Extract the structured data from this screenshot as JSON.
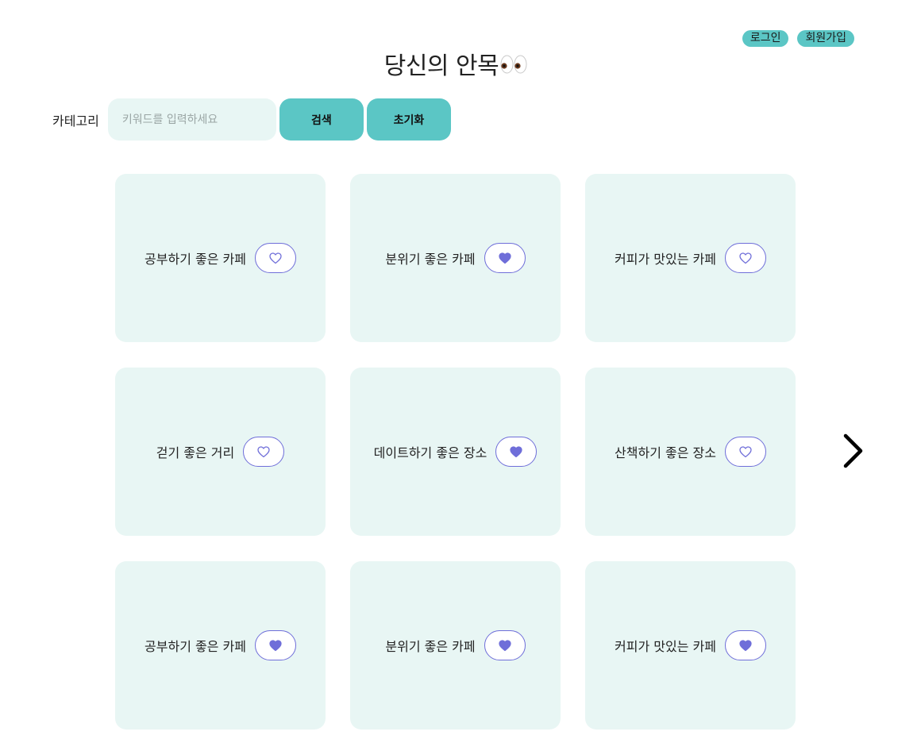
{
  "header": {
    "login_label": "로그인",
    "signup_label": "회원가입",
    "title": "당신의 안목"
  },
  "search": {
    "label": "카테고리",
    "placeholder": "키워드를 입력하세요",
    "value": "",
    "search_button": "검색",
    "reset_button": "초기화"
  },
  "cards": [
    {
      "title": "공부하기 좋은 카페",
      "liked": false
    },
    {
      "title": "분위기 좋은 카페",
      "liked": true
    },
    {
      "title": "커피가 맛있는 카페",
      "liked": false
    },
    {
      "title": "걷기 좋은 거리",
      "liked": false
    },
    {
      "title": "데이트하기 좋은 장소",
      "liked": true
    },
    {
      "title": "산책하기 좋은 장소",
      "liked": false
    },
    {
      "title": "공부하기 좋은 카페",
      "liked": true
    },
    {
      "title": "분위기 좋은 카페",
      "liked": true
    },
    {
      "title": "커피가 맛있는 카페",
      "liked": true
    }
  ],
  "colors": {
    "accent": "#5bc6c5",
    "card_bg": "#e8f6f4",
    "heart": "#6f6ed9"
  },
  "icons": {
    "title_emoji": "eyes-icon",
    "like": "heart-icon",
    "pagination": "chevron-right-icon"
  }
}
